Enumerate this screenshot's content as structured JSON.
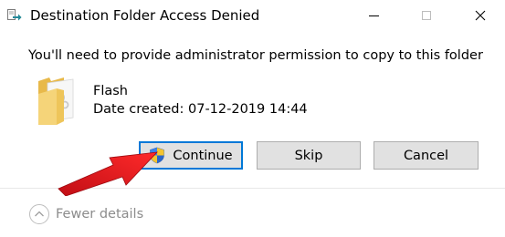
{
  "window": {
    "title": "Destination Folder Access Denied"
  },
  "titlebar_controls": {
    "minimize_icon": "minimize-icon",
    "maximize_icon": "maximize-icon",
    "close_icon": "close-icon"
  },
  "content": {
    "message": "You'll need to provide administrator permission to copy to this folder",
    "item": {
      "name": "Flash",
      "date_created": "Date created: 07-12-2019 14:44",
      "icon": "folder-icon"
    }
  },
  "buttons": {
    "continue_label": "Continue",
    "skip_label": "Skip",
    "cancel_label": "Cancel"
  },
  "details": {
    "label": "Fewer details",
    "icon": "chevron-up-icon"
  },
  "colors": {
    "focus_border": "#0078d7",
    "button_bg": "#e1e1e1",
    "annotation_red": "#e8141c",
    "muted_text": "#8c8c8c"
  }
}
